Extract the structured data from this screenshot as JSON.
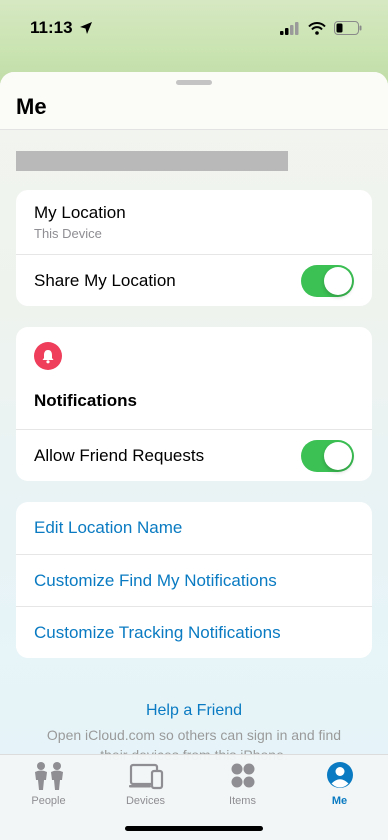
{
  "status": {
    "time": "11:13"
  },
  "header": {
    "title": "Me"
  },
  "location_card": {
    "my_location_label": "My Location",
    "my_location_sub": "This Device",
    "share_label": "Share My Location",
    "share_on": true
  },
  "notifications_card": {
    "title": "Notifications",
    "allow_label": "Allow Friend Requests",
    "allow_on": true,
    "badge_color": "#ee3e5b"
  },
  "links_card": {
    "items": [
      "Edit Location Name",
      "Customize Find My Notifications",
      "Customize Tracking Notifications"
    ]
  },
  "help": {
    "link": "Help a Friend",
    "text": "Open iCloud.com so others can sign in and find their devices from this iPhone."
  },
  "tabbar": {
    "tabs": [
      {
        "label": "People",
        "icon": "people-icon"
      },
      {
        "label": "Devices",
        "icon": "devices-icon"
      },
      {
        "label": "Items",
        "icon": "items-icon"
      },
      {
        "label": "Me",
        "icon": "me-icon",
        "active": true
      }
    ]
  },
  "colors": {
    "accent": "#0a7bc2",
    "toggle_on": "#3cc154"
  }
}
